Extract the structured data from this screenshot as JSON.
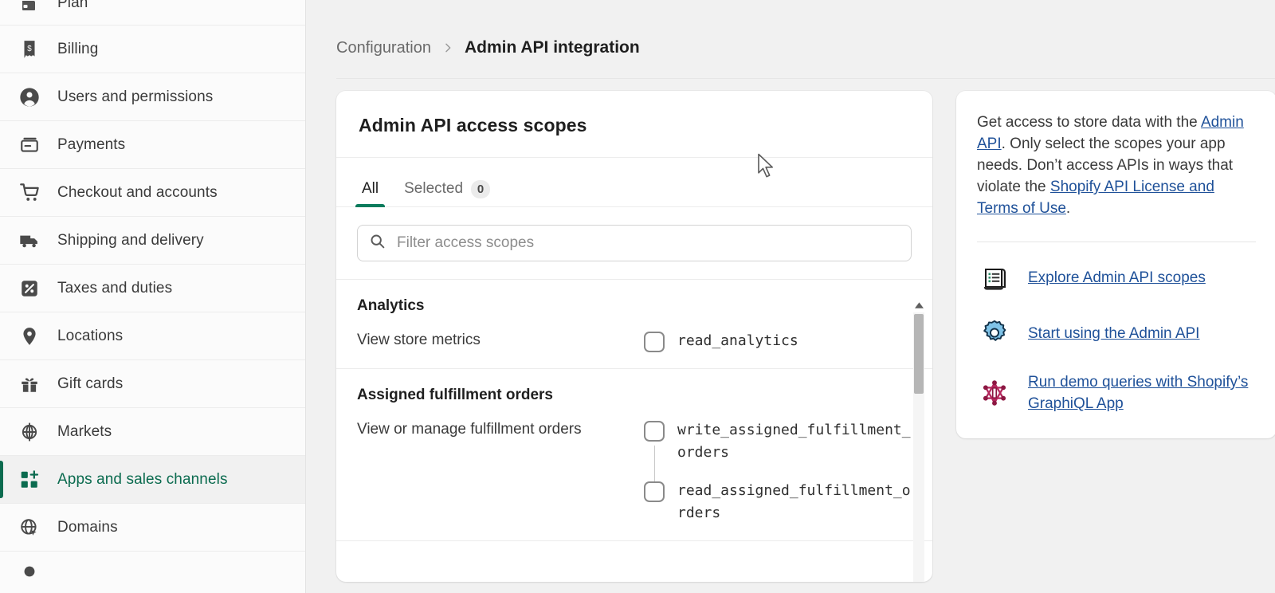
{
  "sidebar": {
    "peek_top_label": "Plan",
    "items": [
      {
        "label": "Billing",
        "icon": "billing-icon",
        "active": false
      },
      {
        "label": "Users and permissions",
        "icon": "user-icon",
        "active": false
      },
      {
        "label": "Payments",
        "icon": "payments-icon",
        "active": false
      },
      {
        "label": "Checkout and accounts",
        "icon": "cart-icon",
        "active": false
      },
      {
        "label": "Shipping and delivery",
        "icon": "truck-icon",
        "active": false
      },
      {
        "label": "Taxes and duties",
        "icon": "percent-icon",
        "active": false
      },
      {
        "label": "Locations",
        "icon": "pin-icon",
        "active": false
      },
      {
        "label": "Gift cards",
        "icon": "gift-icon",
        "active": false
      },
      {
        "label": "Markets",
        "icon": "globe-target-icon",
        "active": false
      },
      {
        "label": "Apps and sales channels",
        "icon": "apps-grid-icon",
        "active": true
      },
      {
        "label": "Domains",
        "icon": "globe-icon",
        "active": false
      }
    ]
  },
  "breadcrumb": {
    "parent": "Configuration",
    "separator": "›",
    "current": "Admin API integration"
  },
  "scopes_card": {
    "title": "Admin API access scopes",
    "tabs": [
      {
        "label": "All",
        "badge": null,
        "selected": true
      },
      {
        "label": "Selected",
        "badge": "0",
        "selected": false
      }
    ],
    "filter_placeholder": "Filter access scopes",
    "filter_value": "",
    "groups": [
      {
        "title": "Analytics",
        "description": "View store metrics",
        "scopes": [
          {
            "name": "read_analytics",
            "checked": false
          }
        ]
      },
      {
        "title": "Assigned fulfillment orders",
        "description": "View or manage fulfillment orders",
        "scopes": [
          {
            "name": "write_assigned_fulfillment_orders",
            "checked": false
          },
          {
            "name": "read_assigned_fulfillment_orders",
            "checked": false
          }
        ]
      }
    ]
  },
  "info_panel": {
    "text_part1": "Get access to store data with the ",
    "link_admin_api": "Admin API",
    "text_part2": ". Only select the scopes your app needs. Don’t access APIs in ways that violate the ",
    "link_license": "Shopify API License and Terms of Use",
    "text_part3": ".",
    "resources": [
      {
        "label": "Explore Admin API scopes",
        "icon": "scroll-document-icon"
      },
      {
        "label": "Start using the Admin API",
        "icon": "gear-icon"
      },
      {
        "label": "Run demo queries with Shopify’s GraphiQL App",
        "icon": "graphql-node-icon"
      }
    ]
  },
  "colors": {
    "accent_green": "#0b7b5c",
    "link_blue": "#1f5199",
    "card_white": "#ffffff",
    "page_bg": "#f1f1f1"
  }
}
